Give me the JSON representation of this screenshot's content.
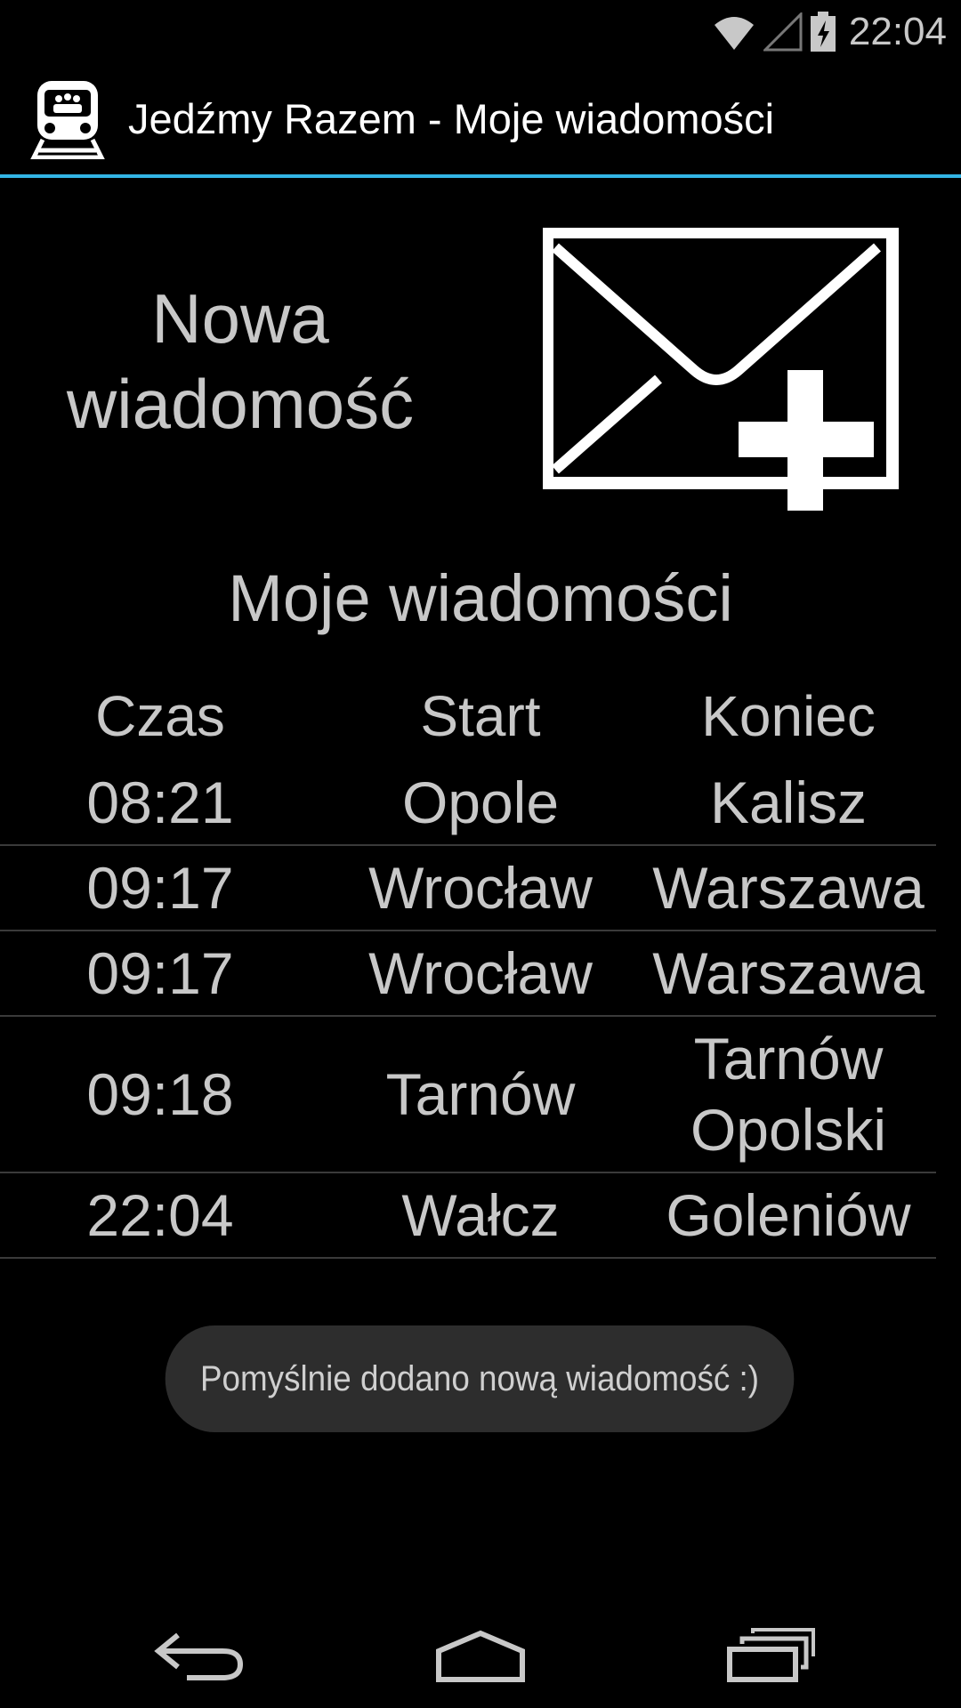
{
  "status_bar": {
    "time": "22:04",
    "icons": [
      "wifi-icon",
      "signal-icon",
      "battery-charging-icon"
    ]
  },
  "action_bar": {
    "title": "Jedźmy Razem - Moje wiadomości",
    "icon": "train-icon"
  },
  "new_message": {
    "label_line1": "Nowa",
    "label_line2": "wiadomość",
    "button_icon": "envelope-add-icon"
  },
  "messages": {
    "title": "Moje wiadomości",
    "columns": [
      "Czas",
      "Start",
      "Koniec"
    ],
    "rows": [
      {
        "time": "08:21",
        "start": "Opole",
        "end": "Kalisz"
      },
      {
        "time": "09:17",
        "start": "Wrocław",
        "end": "Warszawa"
      },
      {
        "time": "09:17",
        "start": "Wrocław",
        "end": "Warszawa"
      },
      {
        "time": "09:18",
        "start": "Tarnów",
        "end_line1": "Tarnów",
        "end_line2": "Opolski"
      },
      {
        "time": "22:04",
        "start": "Wałcz",
        "end": "Goleniów"
      }
    ]
  },
  "toast": {
    "text": "Pomyślnie dodano nową wiadomość :)"
  },
  "nav_bar": {
    "back_icon": "back-icon",
    "home_icon": "home-icon",
    "recents_icon": "recents-icon"
  },
  "colors": {
    "accent": "#33b5e5",
    "background": "#000000",
    "text": "#c8c8c8",
    "toast_bg": "#2d2d2d"
  }
}
